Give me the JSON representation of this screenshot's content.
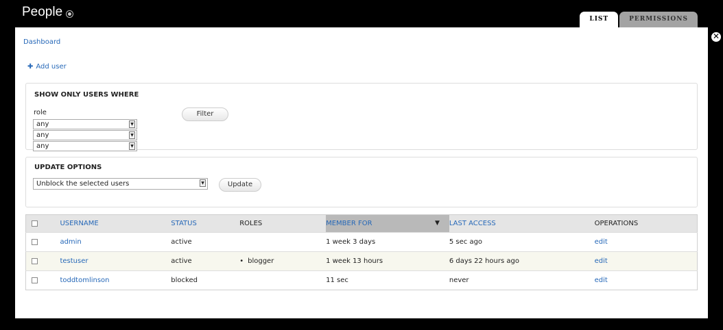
{
  "header": {
    "title": "People",
    "tabs": [
      {
        "label": "LIST",
        "active": true
      },
      {
        "label": "PERMISSIONS",
        "active": false
      }
    ]
  },
  "breadcrumb": "Dashboard",
  "actions": {
    "add_user": "Add user"
  },
  "filter": {
    "legend": "SHOW ONLY USERS WHERE",
    "role_label": "role",
    "selects": [
      "any",
      "any",
      "any"
    ],
    "button": "Filter"
  },
  "update": {
    "legend": "UPDATE OPTIONS",
    "selected_option": "Unblock the selected users",
    "button": "Update"
  },
  "table": {
    "headers": [
      "USERNAME",
      "STATUS",
      "ROLES",
      "MEMBER FOR",
      "LAST ACCESS",
      "OPERATIONS"
    ],
    "rows": [
      {
        "username": "admin",
        "status": "active",
        "roles": "",
        "member_for": "1 week 3 days",
        "last_access": "5 sec ago",
        "operation": "edit"
      },
      {
        "username": "testuser",
        "status": "active",
        "roles": "blogger",
        "member_for": "1 week 13 hours",
        "last_access": "6 days 22 hours ago",
        "operation": "edit"
      },
      {
        "username": "toddtomlinson",
        "status": "blocked",
        "roles": "",
        "member_for": "11 sec",
        "last_access": "never",
        "operation": "edit"
      }
    ]
  },
  "colors": {
    "link": "#2668b8",
    "overlay_bg": "#000000",
    "active_sort_col": "#b9b9b9"
  }
}
